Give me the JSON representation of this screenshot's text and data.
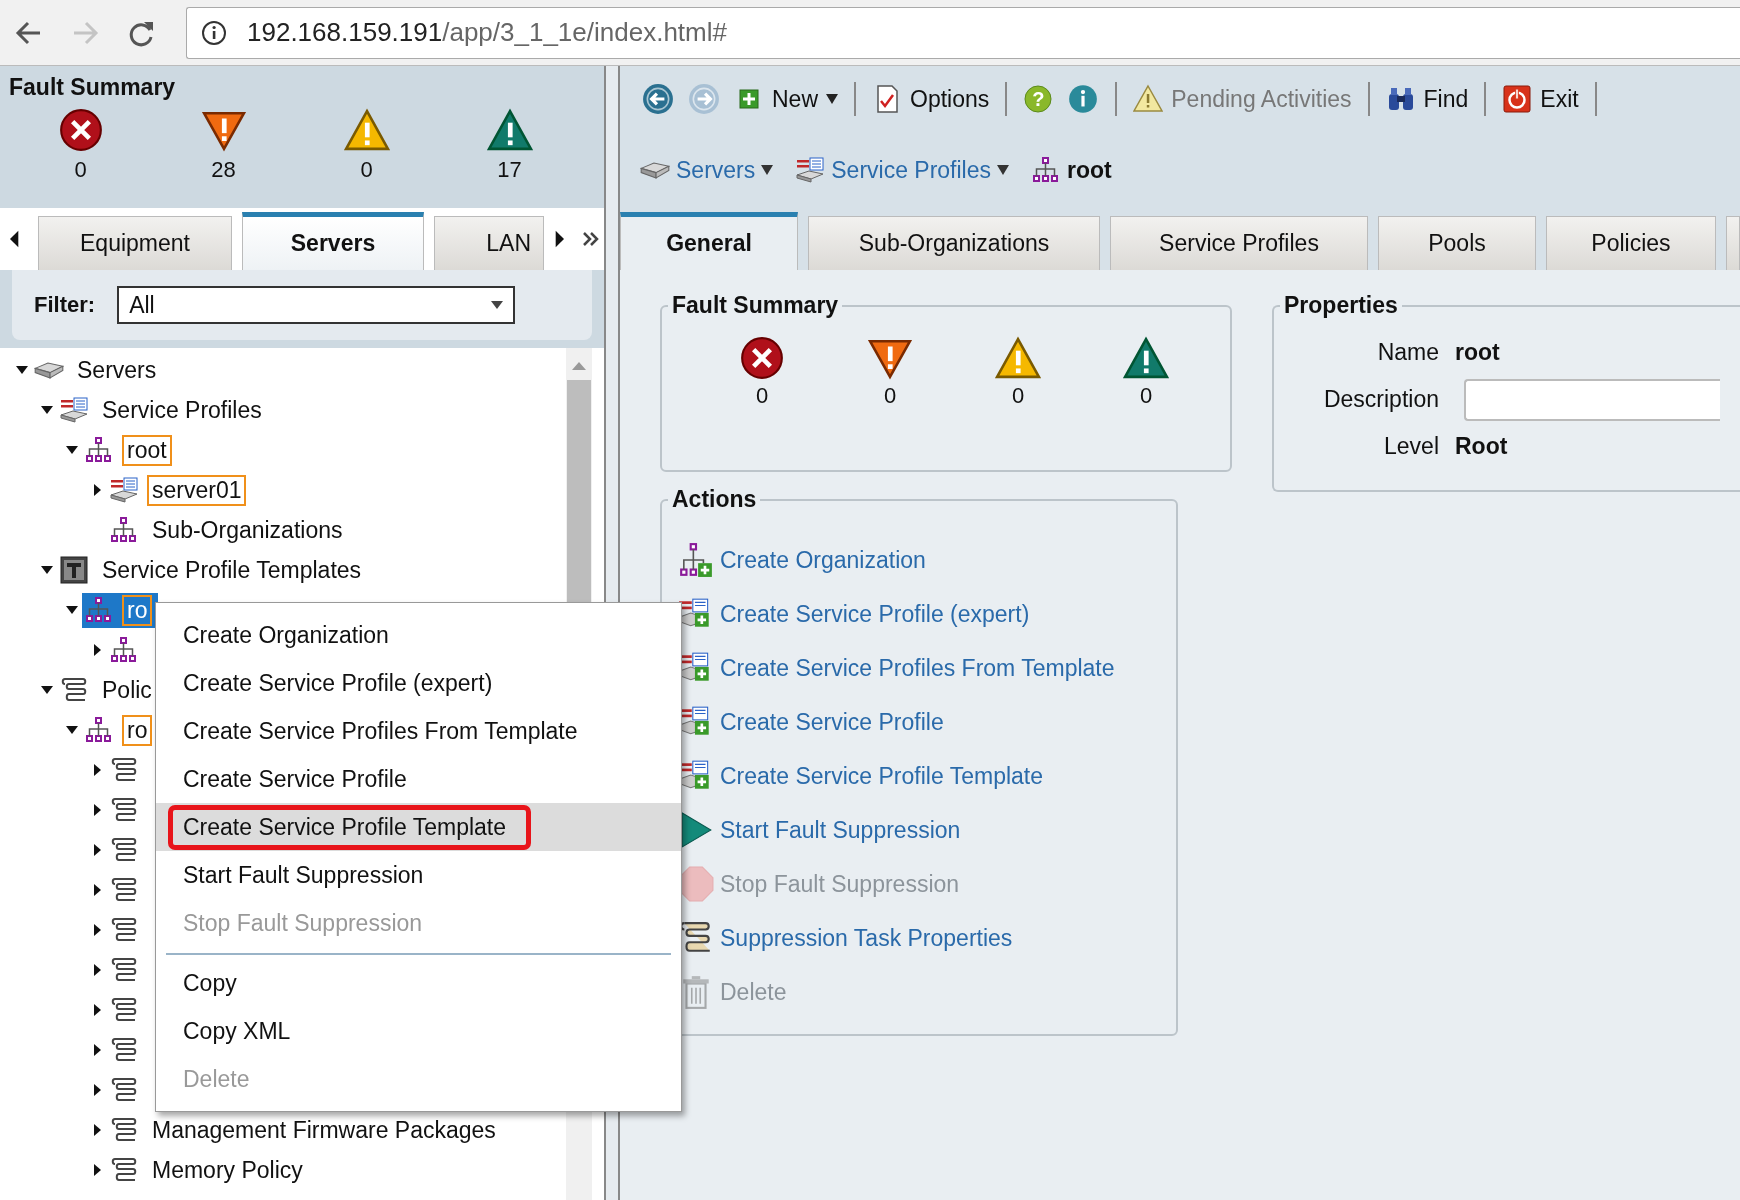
{
  "browser": {
    "back_disabled": false,
    "forward_disabled": true,
    "url_host": "192.168.159.191",
    "url_path": "/app/3_1_1e/index.html#"
  },
  "left_panel": {
    "fault_summary": {
      "title": "Fault Summary",
      "counts": [
        {
          "kind": "critical",
          "count": "0"
        },
        {
          "kind": "major",
          "count": "28"
        },
        {
          "kind": "minor",
          "count": "0"
        },
        {
          "kind": "warning",
          "count": "17"
        }
      ]
    },
    "tabs": [
      {
        "label": "Equipment",
        "selected": false
      },
      {
        "label": "Servers",
        "selected": true
      },
      {
        "label": "LAN",
        "selected": false
      }
    ],
    "filter": {
      "label": "Filter:",
      "value": "All"
    },
    "tree": [
      {
        "kind": "server",
        "label": "Servers",
        "expanded": true,
        "leaf": false,
        "selected": false,
        "highlighted": false,
        "children": [
          {
            "kind": "profile",
            "label": "Service Profiles",
            "expanded": true,
            "leaf": false,
            "selected": false,
            "highlighted": false,
            "children": [
              {
                "kind": "org",
                "label": "root",
                "expanded": true,
                "leaf": false,
                "selected": false,
                "highlighted": true,
                "children": [
                  {
                    "kind": "profile",
                    "label": "server01",
                    "expanded": false,
                    "leaf": false,
                    "selected": false,
                    "highlighted": true
                  },
                  {
                    "kind": "org",
                    "label": "Sub-Organizations",
                    "expanded": false,
                    "leaf": true,
                    "selected": false,
                    "highlighted": false
                  }
                ]
              }
            ]
          },
          {
            "kind": "template",
            "label": "Service Profile Templates",
            "expanded": true,
            "leaf": false,
            "selected": false,
            "highlighted": false,
            "children": [
              {
                "kind": "org",
                "label": "ro",
                "expanded": true,
                "leaf": false,
                "selected": true,
                "highlighted": true,
                "children": [
                  {
                    "kind": "org",
                    "expanded": false,
                    "leaf": false,
                    "selected": false,
                    "highlighted": false
                  }
                ]
              }
            ]
          },
          {
            "kind": "policy",
            "label": "Polic",
            "expanded": true,
            "leaf": false,
            "selected": false,
            "highlighted": false,
            "children": [
              {
                "kind": "org",
                "label": "ro",
                "expanded": true,
                "leaf": false,
                "selected": false,
                "highlighted": true,
                "children": [
                  {
                    "kind": "policy",
                    "expanded": false,
                    "leaf": false,
                    "selected": false,
                    "highlighted": false
                  },
                  {
                    "kind": "policy",
                    "expanded": false,
                    "leaf": false,
                    "selected": false,
                    "highlighted": false
                  },
                  {
                    "kind": "policy",
                    "expanded": false,
                    "leaf": false,
                    "selected": false,
                    "highlighted": false
                  },
                  {
                    "kind": "policy",
                    "expanded": false,
                    "leaf": false,
                    "selected": false,
                    "highlighted": false
                  },
                  {
                    "kind": "policy",
                    "expanded": false,
                    "leaf": false,
                    "selected": false,
                    "highlighted": false
                  },
                  {
                    "kind": "policy",
                    "expanded": false,
                    "leaf": false,
                    "selected": false,
                    "highlighted": false
                  },
                  {
                    "kind": "policy",
                    "expanded": false,
                    "leaf": false,
                    "selected": false,
                    "highlighted": false
                  },
                  {
                    "kind": "policy",
                    "expanded": false,
                    "leaf": false,
                    "selected": false,
                    "highlighted": false
                  },
                  {
                    "kind": "policy",
                    "expanded": false,
                    "leaf": false,
                    "selected": false,
                    "highlighted": false
                  },
                  {
                    "kind": "policy",
                    "label": "Management Firmware Packages",
                    "expanded": false,
                    "leaf": false,
                    "selected": false,
                    "highlighted": false
                  },
                  {
                    "kind": "policy",
                    "label": "Memory Policy",
                    "expanded": false,
                    "leaf": false,
                    "selected": false,
                    "highlighted": false
                  }
                ]
              }
            ]
          }
        ]
      }
    ]
  },
  "context_menu": {
    "items": [
      {
        "kind": "item",
        "label": "Create Organization",
        "disabled": false,
        "selected": false
      },
      {
        "kind": "item",
        "label": "Create Service Profile (expert)",
        "disabled": false,
        "selected": false
      },
      {
        "kind": "item",
        "label": "Create Service Profiles From Template",
        "disabled": false,
        "selected": false
      },
      {
        "kind": "item",
        "label": "Create Service Profile",
        "disabled": false,
        "selected": false
      },
      {
        "kind": "item",
        "label": "Create Service Profile Template",
        "disabled": false,
        "selected": true
      },
      {
        "kind": "item",
        "label": "Start Fault Suppression",
        "disabled": false,
        "selected": false
      },
      {
        "kind": "item",
        "label": "Stop Fault Suppression",
        "disabled": true,
        "selected": false
      },
      {
        "kind": "separator"
      },
      {
        "kind": "item",
        "label": "Copy",
        "disabled": false,
        "selected": false
      },
      {
        "kind": "item",
        "label": "Copy XML",
        "disabled": false,
        "selected": false
      },
      {
        "kind": "item",
        "label": "Delete",
        "disabled": true,
        "selected": false
      }
    ]
  },
  "toolbar": [
    {
      "kind": "back",
      "disabled": false
    },
    {
      "kind": "forward",
      "disabled": true
    },
    {
      "kind": "new",
      "label": "New",
      "disabled": false,
      "dropdown": true
    },
    {
      "kind": "separator"
    },
    {
      "kind": "options",
      "label": "Options",
      "disabled": false,
      "dropdown": false
    },
    {
      "kind": "separator"
    },
    {
      "kind": "help",
      "glyph": "?"
    },
    {
      "kind": "info"
    },
    {
      "kind": "separator"
    },
    {
      "kind": "pending",
      "label": "Pending Activities",
      "disabled": true,
      "dropdown": false
    },
    {
      "kind": "separator"
    },
    {
      "kind": "find",
      "label": "Find",
      "disabled": false,
      "dropdown": false
    },
    {
      "kind": "separator"
    },
    {
      "kind": "exit",
      "label": "Exit",
      "disabled": false,
      "dropdown": false
    },
    {
      "kind": "separator"
    }
  ],
  "breadcrumb": [
    {
      "kind": "server",
      "label": "Servers",
      "dropdown": true
    },
    {
      "kind": "profile",
      "label": "Service Profiles",
      "dropdown": true
    },
    {
      "kind": "org",
      "label": "root",
      "dropdown": false
    }
  ],
  "tabs": [
    {
      "label": "General",
      "selected": true
    },
    {
      "label": "Sub-Organizations",
      "selected": false
    },
    {
      "label": "Service Profiles",
      "selected": false
    },
    {
      "label": "Pools",
      "selected": false
    },
    {
      "label": "Policies",
      "selected": false
    }
  ],
  "fault_summary": {
    "title": "Fault Summary",
    "counts": [
      {
        "kind": "critical",
        "count": "0"
      },
      {
        "kind": "major",
        "count": "0"
      },
      {
        "kind": "minor",
        "count": "0"
      },
      {
        "kind": "warning",
        "count": "0"
      }
    ]
  },
  "properties": {
    "title": "Properties",
    "fields": [
      {
        "kind": "text",
        "label": "Name",
        "value": "root"
      },
      {
        "kind": "input",
        "label": "Description"
      },
      {
        "kind": "text",
        "label": "Level",
        "value": "Root"
      }
    ]
  },
  "actions": {
    "title": "Actions",
    "items": [
      {
        "kind": "org-add",
        "label": "Create Organization",
        "disabled": false
      },
      {
        "kind": "profile-add",
        "label": "Create Service Profile (expert)",
        "disabled": false
      },
      {
        "kind": "profile-add",
        "label": "Create Service Profiles From Template",
        "disabled": false
      },
      {
        "kind": "profile-add",
        "label": "Create Service Profile",
        "disabled": false
      },
      {
        "kind": "profile-add",
        "label": "Create Service Profile Template",
        "disabled": false
      },
      {
        "kind": "play",
        "label": "Start Fault Suppression",
        "disabled": false
      },
      {
        "kind": "stop",
        "label": "Stop Fault Suppression",
        "disabled": true
      },
      {
        "kind": "scroll",
        "label": "Suppression Task Properties",
        "disabled": false
      },
      {
        "kind": "trash",
        "label": "Delete",
        "disabled": true
      }
    ]
  }
}
